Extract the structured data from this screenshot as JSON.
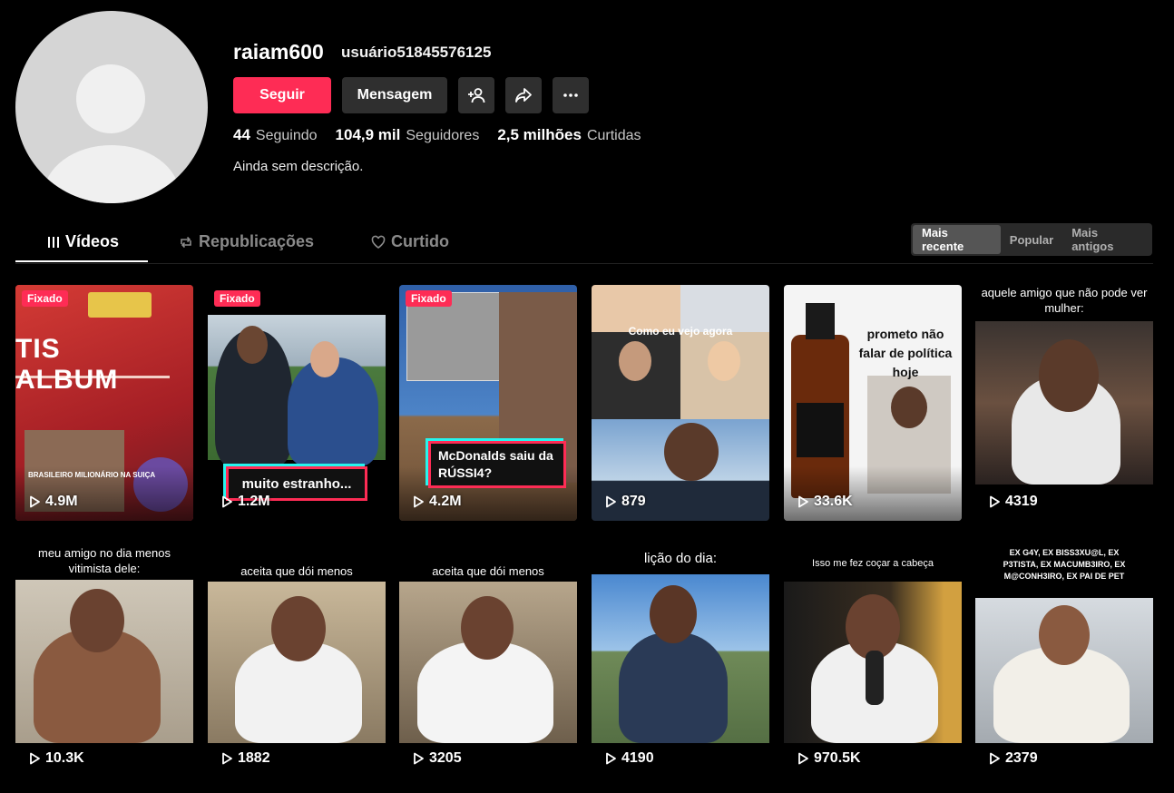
{
  "profile": {
    "username": "raiam600",
    "handle": "usuário51845576125",
    "follow_label": "Seguir",
    "message_label": "Mensagem",
    "stats": [
      {
        "num": "44",
        "label": "Seguindo"
      },
      {
        "num": "104,9 mil",
        "label": "Seguidores"
      },
      {
        "num": "2,5 milhões",
        "label": "Curtidas"
      }
    ],
    "bio": "Ainda sem descrição."
  },
  "tabs": [
    {
      "label": "Vídeos",
      "icon": "grid-icon"
    },
    {
      "label": "Republicações",
      "icon": "repost-icon"
    },
    {
      "label": "Curtido",
      "icon": "heart-outline-icon"
    }
  ],
  "sort": [
    "Mais recente",
    "Popular",
    "Mais antigos"
  ],
  "colors": {
    "accent": "#fe2c55",
    "button": "#2f2f2f",
    "bg": "#000000"
  },
  "videos": [
    {
      "views": "4.9M",
      "pinned": "Fixado",
      "overlay": "TIS ALBUM",
      "caption": "BRASILEIRO MILIONÁRIO NA SUIÇA"
    },
    {
      "views": "1.2M",
      "pinned": "Fixado",
      "overlay": "muito estranho..."
    },
    {
      "views": "4.2M",
      "pinned": "Fixado",
      "overlay": "McDonalds saiu da RÚSSI4?"
    },
    {
      "views": "879",
      "overlay": "Como eu vejo agora"
    },
    {
      "views": "33.6K",
      "overlay": "prometo não falar de política hoje"
    },
    {
      "views": "4319",
      "caption": "aquele amigo que não pode ver mulher:"
    },
    {
      "views": "10.3K",
      "caption": "meu amigo no dia menos vitimista dele:"
    },
    {
      "views": "1882",
      "caption": "aceita que dói menos"
    },
    {
      "views": "3205",
      "caption": "aceita que dói menos"
    },
    {
      "views": "4190",
      "caption": "lição do dia:"
    },
    {
      "views": "970.5K",
      "caption": "Isso me fez coçar a cabeça"
    },
    {
      "views": "2379",
      "caption": "EX G4Y, EX BISS3XU@L, EX P3TISTA, EX MACUMB3IRO, EX M@CONH3IRO, EX PAI DE PET"
    }
  ]
}
